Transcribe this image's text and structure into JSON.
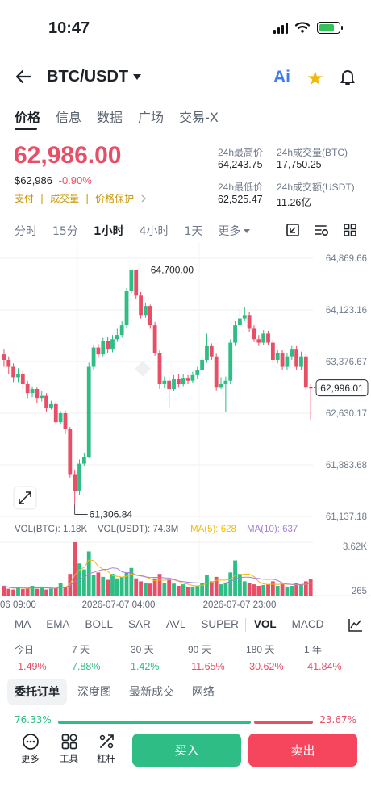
{
  "status": {
    "time": "10:47"
  },
  "header": {
    "pair": "BTC/USDT",
    "ai_label": "Ai"
  },
  "tabs": [
    {
      "label": "价格",
      "active": true
    },
    {
      "label": "信息"
    },
    {
      "label": "数据"
    },
    {
      "label": "广场"
    },
    {
      "label": "交易-X"
    }
  ],
  "price": {
    "last": "62,986.00",
    "usd": "$62,986",
    "change": "-0.90%",
    "links": [
      "支付",
      "成交量",
      "价格保护"
    ]
  },
  "stats": {
    "high_label": "24h最高价",
    "high": "64,243.75",
    "vol_btc_label": "24h成交量(BTC)",
    "vol_btc": "17,750.25",
    "low_label": "24h最低价",
    "low": "62,525.47",
    "vol_usdt_label": "24h成交额(USDT)",
    "vol_usdt": "11.26亿"
  },
  "intervals": [
    {
      "label": "分时"
    },
    {
      "label": "15分"
    },
    {
      "label": "1小时",
      "active": true
    },
    {
      "label": "4小时"
    },
    {
      "label": "1天"
    },
    {
      "label": "更多"
    }
  ],
  "chart_data": {
    "type": "candlestick",
    "y_ticks": [
      "64,869.66",
      "64,123.16",
      "63,376.67",
      "62,630.17",
      "61,883.68",
      "61,137.18"
    ],
    "ylim": [
      61137.18,
      64869.66
    ],
    "current_price_label": "62,996.01",
    "high_marker": "64,700.00",
    "low_marker": "61,306.84",
    "x_ticks": [
      "06 09:00",
      "2026-07-07 04:00",
      "2026-07-07 23:00"
    ],
    "candles": [
      [
        63480,
        63400,
        63550,
        63300
      ],
      [
        63400,
        63300,
        63450,
        63200
      ],
      [
        63300,
        63150,
        63350,
        63080
      ],
      [
        63150,
        63200,
        63280,
        63080
      ],
      [
        63200,
        63050,
        63260,
        62980
      ],
      [
        63050,
        62920,
        63100,
        62850
      ],
      [
        62920,
        62980,
        63020,
        62860
      ],
      [
        62980,
        62850,
        63010,
        62780
      ],
      [
        62850,
        62880,
        62950,
        62800
      ],
      [
        62880,
        62700,
        62920,
        62650
      ],
      [
        62700,
        62760,
        62810,
        62680
      ],
      [
        62760,
        62500,
        62790,
        62460
      ],
      [
        62500,
        62630,
        62660,
        62470
      ],
      [
        62630,
        62400,
        62670,
        62330
      ],
      [
        62400,
        61750,
        62430,
        61700
      ],
      [
        61750,
        61500,
        61800,
        61306.84
      ],
      [
        61500,
        61900,
        61960,
        61450
      ],
      [
        61900,
        62000,
        62060,
        61860
      ],
      [
        62000,
        63300,
        63360,
        61980
      ],
      [
        63300,
        63580,
        63620,
        63260
      ],
      [
        63580,
        63480,
        63630,
        63440
      ],
      [
        63480,
        63680,
        63720,
        63450
      ],
      [
        63680,
        63550,
        63730,
        63500
      ],
      [
        63550,
        63700,
        63760,
        63510
      ],
      [
        63700,
        63760,
        63850,
        63660
      ],
      [
        63760,
        63900,
        63960,
        63720
      ],
      [
        63900,
        64400,
        64440,
        63860
      ],
      [
        64400,
        64700,
        64700,
        64360
      ],
      [
        64700,
        64330,
        64700,
        64280
      ],
      [
        64330,
        64050,
        64380,
        64000
      ],
      [
        64050,
        64180,
        64230,
        64010
      ],
      [
        64180,
        63900,
        64200,
        63850
      ],
      [
        63900,
        63500,
        63950,
        63460
      ],
      [
        63500,
        63050,
        63540,
        62980
      ],
      [
        63050,
        63100,
        63160,
        62990
      ],
      [
        63100,
        62980,
        63150,
        62700
      ],
      [
        62980,
        63120,
        63180,
        62950
      ],
      [
        63120,
        63050,
        63200,
        63000
      ],
      [
        63050,
        63130,
        63200,
        63020
      ],
      [
        63130,
        63100,
        63180,
        63050
      ],
      [
        63100,
        63180,
        63230,
        63060
      ],
      [
        63180,
        63250,
        63300,
        63120
      ],
      [
        63250,
        63400,
        63460,
        63200
      ],
      [
        63400,
        63600,
        63780,
        63360
      ],
      [
        63600,
        63450,
        63640,
        63400
      ],
      [
        63450,
        63000,
        63490,
        62960
      ],
      [
        63000,
        63050,
        63150,
        62980
      ],
      [
        63050,
        63100,
        63160,
        62650
      ],
      [
        63100,
        63650,
        63700,
        63050
      ],
      [
        63650,
        63900,
        63960,
        63600
      ],
      [
        63900,
        64000,
        64120,
        63860
      ],
      [
        64000,
        64050,
        64160,
        63960
      ],
      [
        64050,
        63850,
        64100,
        63800
      ],
      [
        63850,
        63700,
        63900,
        63660
      ],
      [
        63700,
        63650,
        63760,
        63600
      ],
      [
        63650,
        63780,
        63830,
        63620
      ],
      [
        63780,
        63650,
        63820,
        63620
      ],
      [
        63650,
        63400,
        63700,
        63360
      ],
      [
        63400,
        63500,
        63540,
        63350
      ],
      [
        63500,
        63300,
        63540,
        63260
      ],
      [
        63300,
        63450,
        63500,
        63250
      ],
      [
        63450,
        63550,
        63600,
        63400
      ],
      [
        63550,
        63300,
        63600,
        63260
      ],
      [
        63300,
        63450,
        63520,
        63250
      ],
      [
        63450,
        63000,
        63490,
        62960
      ],
      [
        63000,
        62996.01,
        63050,
        62525.47
      ]
    ],
    "volume_label": "VOL(BTC): 1.18K",
    "volume_usdt_label": "VOL(USDT): 74.3M",
    "ma5_label": "MA(5): 628",
    "ma10_label": "MA(10): 637",
    "volume_ticks": [
      "3.62K",
      "265"
    ],
    "volume_range": [
      265,
      3620
    ],
    "volumes": [
      700,
      500,
      450,
      600,
      480,
      550,
      700,
      500,
      650,
      450,
      500,
      550,
      900,
      600,
      1500,
      3620,
      2200,
      1800,
      3000,
      1400,
      1600,
      1300,
      1100,
      1500,
      1200,
      1300,
      1600,
      1900,
      1200,
      1000,
      900,
      850,
      1200,
      1500,
      900,
      1100,
      850,
      700,
      800,
      600,
      650,
      700,
      900,
      1400,
      1000,
      1300,
      800,
      900,
      1600,
      2400,
      1500,
      1000,
      900,
      800,
      700,
      750,
      800,
      1000,
      700,
      900,
      650,
      700,
      900,
      750,
      1000,
      1180
    ]
  },
  "indicators": [
    {
      "label": "MA"
    },
    {
      "label": "EMA"
    },
    {
      "label": "BOLL"
    },
    {
      "label": "SAR"
    },
    {
      "label": "AVL"
    },
    {
      "label": "SUPER"
    },
    {
      "label": "VOL",
      "active": true
    },
    {
      "label": "MACD"
    }
  ],
  "performance": [
    {
      "label": "今日",
      "value": "-1.49%",
      "dir": "down"
    },
    {
      "label": "7 天",
      "value": "7.88%",
      "dir": "up"
    },
    {
      "label": "30 天",
      "value": "1.42%",
      "dir": "up"
    },
    {
      "label": "90 天",
      "value": "-11.65%",
      "dir": "down"
    },
    {
      "label": "180 天",
      "value": "-30.62%",
      "dir": "down"
    },
    {
      "label": "1 年",
      "value": "-41.84%",
      "dir": "down"
    }
  ],
  "book_tabs": [
    {
      "label": "委托订单",
      "active": true
    },
    {
      "label": "深度图"
    },
    {
      "label": "最新成交"
    },
    {
      "label": "网络"
    }
  ],
  "ratio": {
    "buy": "76.33%",
    "sell": "23.67%",
    "buy_fraction": 0.7633
  },
  "bottom_nav": {
    "more": "更多",
    "tools": "工具",
    "leverage": "杠杆",
    "buy": "买入",
    "sell": "卖出"
  },
  "colors": {
    "up": "#2ebd85",
    "down": "#e84e66",
    "ma5": "#f0b90b",
    "ma10": "#a47ed9"
  }
}
